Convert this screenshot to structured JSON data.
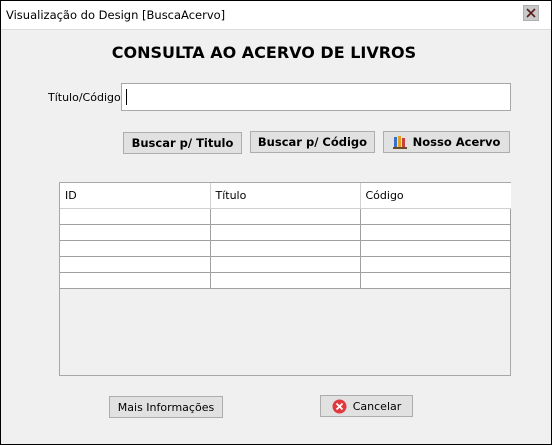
{
  "window": {
    "title": "Visualização do Design [BuscaAcervo]",
    "close_icon": "close-icon"
  },
  "main": {
    "heading": "CONSULTA AO ACERVO DE LIVROS",
    "field_label": "Título/Código",
    "search_value": "",
    "buttons": {
      "search_title": "Buscar p/ Titulo",
      "search_code": "Buscar p/ Código",
      "our_collection": "Nosso Acervo"
    },
    "table": {
      "columns": [
        "ID",
        "Título",
        "Código"
      ],
      "rows": [
        [
          "",
          "",
          ""
        ],
        [
          "",
          "",
          ""
        ],
        [
          "",
          "",
          ""
        ],
        [
          "",
          "",
          ""
        ],
        [
          "",
          "",
          ""
        ]
      ]
    },
    "footer": {
      "more_info": "Mais Informações",
      "cancel": "Cancelar"
    }
  },
  "colors": {
    "cancel_icon": "#e0393e",
    "books_icon": "#3a6fc9"
  }
}
